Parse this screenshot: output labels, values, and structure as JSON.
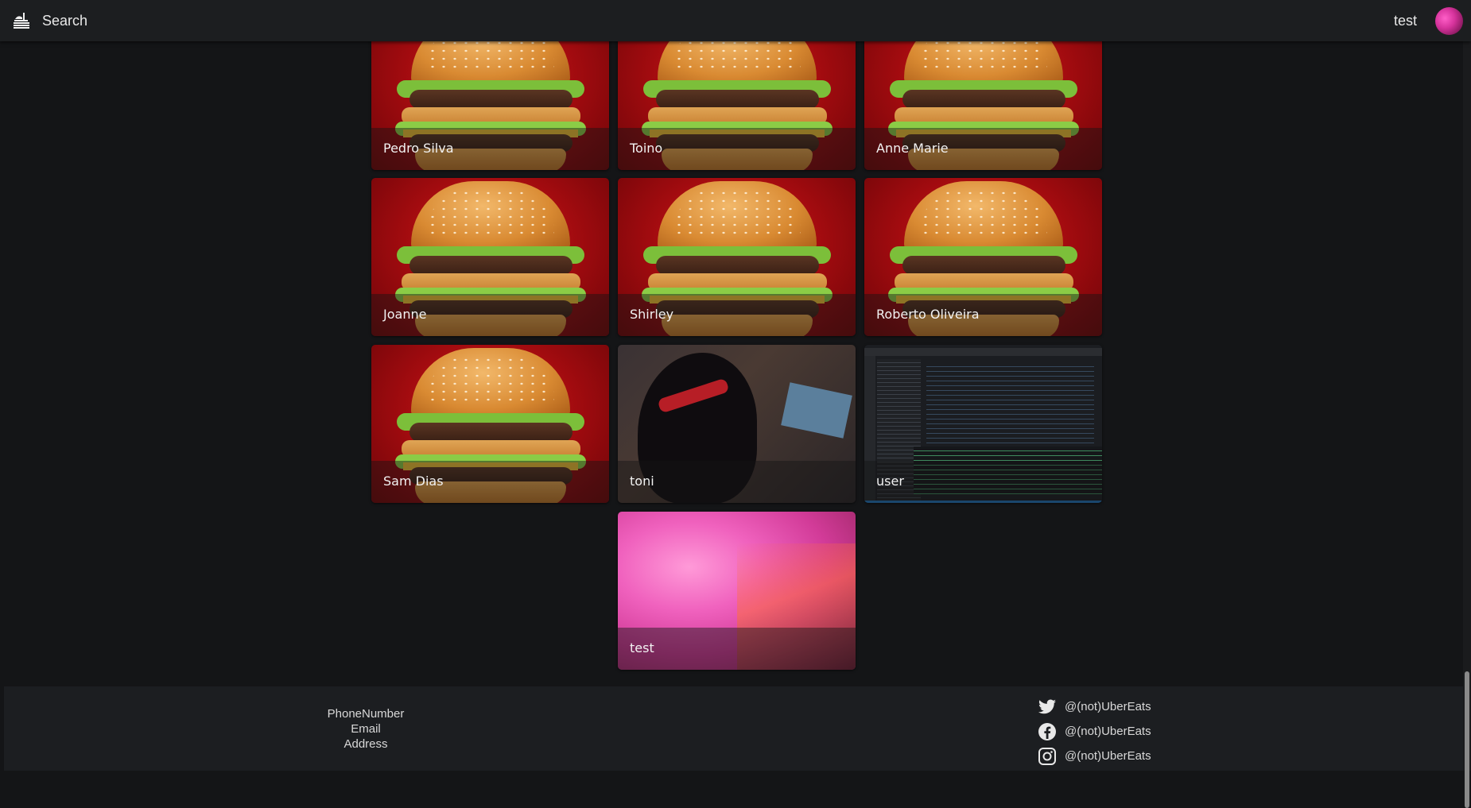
{
  "header": {
    "search_label": "Search",
    "user_name": "test",
    "logo_icon": "restaurant-logo-icon",
    "avatar_color": "#d6339c"
  },
  "cards": [
    {
      "name": "Pedro Silva",
      "image": "burger"
    },
    {
      "name": "Toino",
      "image": "burger"
    },
    {
      "name": "Anne Marie",
      "image": "burger"
    },
    {
      "name": "Joanne",
      "image": "burger"
    },
    {
      "name": "Shirley",
      "image": "burger"
    },
    {
      "name": "Roberto Oliveira",
      "image": "burger"
    },
    {
      "name": "Sam Dias",
      "image": "burger"
    },
    {
      "name": "toni",
      "image": "cartoon"
    },
    {
      "name": "user",
      "image": "code-screenshot"
    },
    {
      "name": "test",
      "image": "pink-abstract"
    }
  ],
  "footer": {
    "contact": {
      "phone": "PhoneNumber",
      "email": "Email",
      "address": "Address"
    },
    "social": [
      {
        "icon": "twitter-icon",
        "handle": "@(not)UberEats"
      },
      {
        "icon": "facebook-icon",
        "handle": "@(not)UberEats"
      },
      {
        "icon": "instagram-icon",
        "handle": "@(not)UberEats"
      }
    ]
  }
}
